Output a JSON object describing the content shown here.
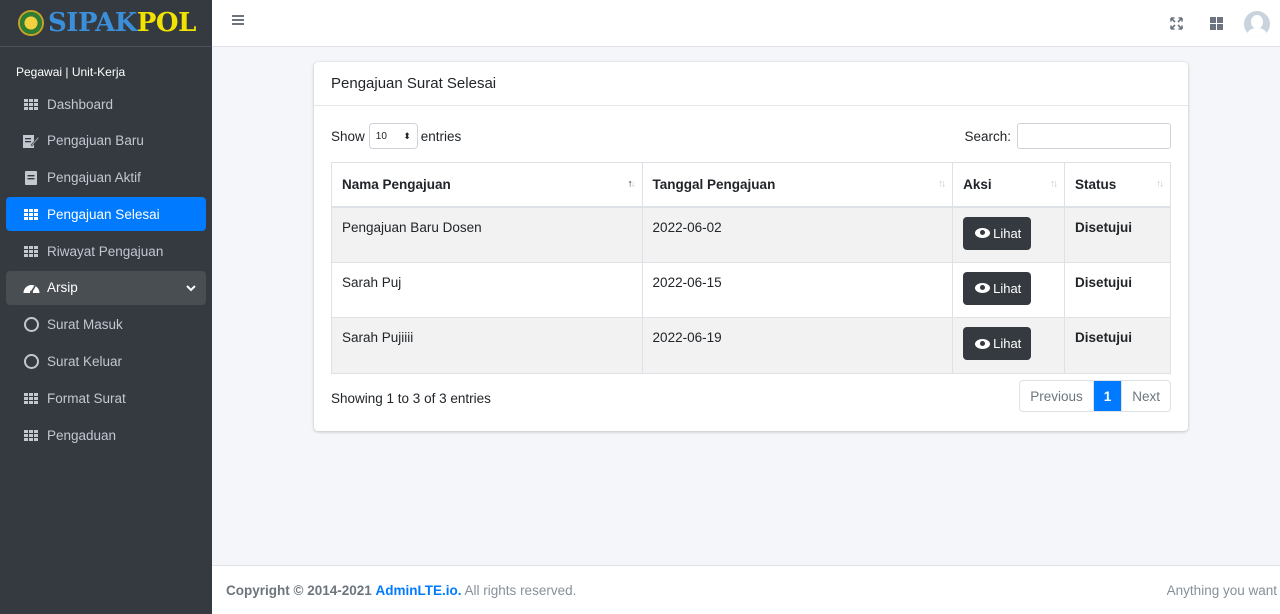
{
  "brand": {
    "part1": "SIPAK",
    "part2": "POL"
  },
  "user": {
    "label": "Pegawai | Unit-Kerja"
  },
  "sidebar": {
    "items": [
      {
        "label": "Dashboard",
        "icon": "grid-icon"
      },
      {
        "label": "Pengajuan Baru",
        "icon": "edit-icon"
      },
      {
        "label": "Pengajuan Aktif",
        "icon": "document-icon"
      },
      {
        "label": "Pengajuan Selesai",
        "icon": "grid-icon",
        "active": true
      },
      {
        "label": "Riwayat Pengajuan",
        "icon": "grid-icon"
      },
      {
        "label": "Arsip",
        "icon": "dashboard-gauge-icon",
        "open": true
      },
      {
        "label": "Surat Masuk",
        "icon": "circle-icon"
      },
      {
        "label": "Surat Keluar",
        "icon": "circle-icon"
      },
      {
        "label": "Format Surat",
        "icon": "grid-icon"
      },
      {
        "label": "Pengaduan",
        "icon": "grid-icon"
      }
    ]
  },
  "card": {
    "title": "Pengajuan Surat Selesai",
    "show_label": "Show",
    "entries_value": "10",
    "entries_label": "entries",
    "search_label": "Search:",
    "columns": [
      "Nama Pengajuan",
      "Tanggal Pengajuan",
      "Aksi",
      "Status"
    ],
    "rows": [
      {
        "nama": "Pengajuan Baru Dosen",
        "tanggal": "2022-06-02",
        "aksi": "Lihat",
        "status": "Disetujui"
      },
      {
        "nama": "Sarah Puj",
        "tanggal": "2022-06-15",
        "aksi": "Lihat",
        "status": "Disetujui"
      },
      {
        "nama": "Sarah Pujiiii",
        "tanggal": "2022-06-19",
        "aksi": "Lihat",
        "status": "Disetujui"
      }
    ],
    "info": "Showing 1 to 3 of 3 entries",
    "pager": {
      "previous": "Previous",
      "current": "1",
      "next": "Next"
    }
  },
  "footer": {
    "copyright": "Copyright © 2014-2021",
    "link": "AdminLTE.io.",
    "rights": "All rights reserved.",
    "right_text": "Anything you want"
  },
  "colors": {
    "primary": "#007bff",
    "sidebar": "#343a40",
    "brand_blue": "#3b8fd9",
    "brand_yellow": "#f2e200"
  }
}
